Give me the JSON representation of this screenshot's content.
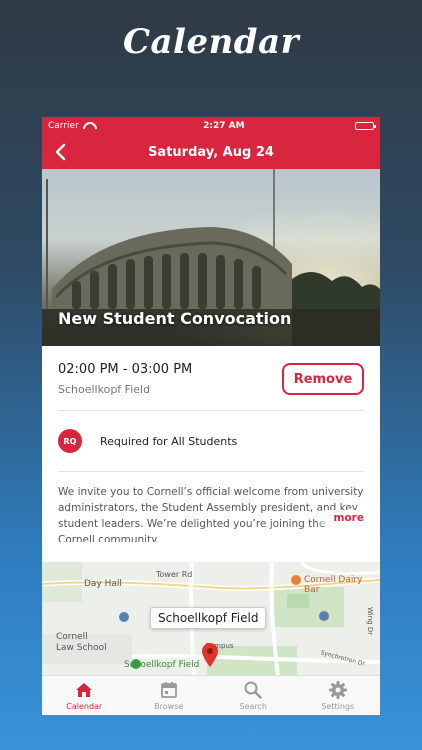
{
  "promo": {
    "title": "Calendar"
  },
  "status_bar": {
    "carrier": "Carrier",
    "time": "2:27 AM"
  },
  "nav": {
    "title": "Saturday, Aug 24"
  },
  "event": {
    "title": "New Student Convocation",
    "time": "02:00 PM - 03:00 PM",
    "location": "Schoellkopf Field",
    "remove_label": "Remove",
    "badge": "RQ",
    "requirement": "Required for All Students",
    "description": "We invite you to Cornell’s official welcome from university administrators, the Student Assembly president, and key student leaders. We’re delighted you’re joining the Cornell community.",
    "more_label": "more"
  },
  "map": {
    "labels": {
      "day_hall": "Day Hall",
      "tower_rd": "Tower Rd",
      "dairy_bar": "Cornell Dairy Bar",
      "wing_dr": "Wing Dr",
      "law_school": "Cornell\nLaw School",
      "campus": "Campus",
      "field": "Schoellkopf Field",
      "synchrotron": "Synchrotron Dr"
    },
    "callout": "Schoellkopf Field"
  },
  "tabs": [
    {
      "label": "Calendar",
      "icon": "home-icon"
    },
    {
      "label": "Browse",
      "icon": "calendar-icon"
    },
    {
      "label": "Search",
      "icon": "search-icon"
    },
    {
      "label": "Settings",
      "icon": "gear-icon"
    }
  ],
  "colors": {
    "accent": "#d7263d",
    "inactive": "#999999"
  }
}
